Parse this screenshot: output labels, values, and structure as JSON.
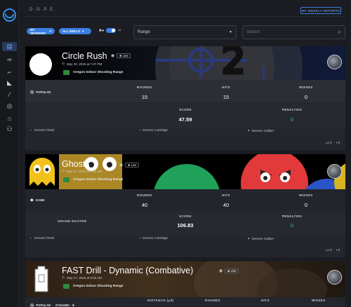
{
  "app": {
    "brand": "D.O.P.E.",
    "weekly_button": "MY WEEKLY REPORTS"
  },
  "nav": {
    "items": [
      {
        "name": "sessions-icon",
        "glyph": "▤"
      },
      {
        "name": "rifle-icon",
        "glyph": "➾"
      },
      {
        "name": "pistol-icon",
        "glyph": "⌐"
      },
      {
        "name": "shoe-icon",
        "glyph": "◣"
      },
      {
        "name": "bullet-icon",
        "glyph": "⁄"
      },
      {
        "name": "target-icon",
        "glyph": "◎"
      },
      {
        "name": "range-building-icon",
        "glyph": "⌂"
      },
      {
        "name": "group-icon",
        "glyph": "⚇"
      }
    ]
  },
  "filters": {
    "sessions_chip": "MY SESSIONS",
    "drills_chip": "ALL DRILLS",
    "range_placeholder": "Range",
    "search_placeholder": "Search"
  },
  "cards": [
    {
      "title": "Circle Rush",
      "date": "May 30, 2025 at 7:47 PM",
      "live": "Live",
      "range": "Oregon Indoor Shooting Range",
      "tag": "POPULAR",
      "labels": {
        "rounds": "ROUNDS",
        "hits": "HITS",
        "misses": "MISSES",
        "score": "SCORE",
        "penalties": "PENALTIES"
      },
      "rounds": "15",
      "hits": "15",
      "misses": "0",
      "score": "47.59",
      "penalties": "0",
      "firearm": "Generic Pistol",
      "ammo": "Generic Cartridge",
      "caliber": "Generic Caliber",
      "likes": "0",
      "comments": "0"
    },
    {
      "title": "Ghosts",
      "date": "May 27, 2025 at 5:18 AM",
      "live": "Live",
      "range": "Oregon Indoor Shooting Range",
      "tag": "GAME",
      "labels": {
        "rounds": "ROUNDS",
        "hits": "HITS",
        "misses": "MISSES",
        "score": "SCORE",
        "penalties": "PENALTIES"
      },
      "rounds": "40",
      "hits": "40",
      "misses": "0",
      "rank": "GRAND MASTER",
      "score": "106.83",
      "penalties": "0",
      "firearm": "Generic Pistol",
      "ammo": "Generic Cartridge",
      "caliber": "Generic Caliber",
      "likes": "0",
      "comments": "0"
    },
    {
      "title": "FAST Drill - Dynamic (Combative)",
      "date": "May 27, 2025 at 5:50 AM",
      "live": "Live",
      "range": "Oregon Indoor Shooting Range",
      "tag": "POPULAR",
      "tag2": "DYNAMIC",
      "labels": {
        "distance": "DISTANCE (yd)",
        "rounds": "ROUNDS",
        "hits": "HITS",
        "misses": "MISSES"
      }
    }
  ],
  "colors": {
    "accent": "#3a7fe3",
    "penalty_green": "#3ec28b"
  }
}
